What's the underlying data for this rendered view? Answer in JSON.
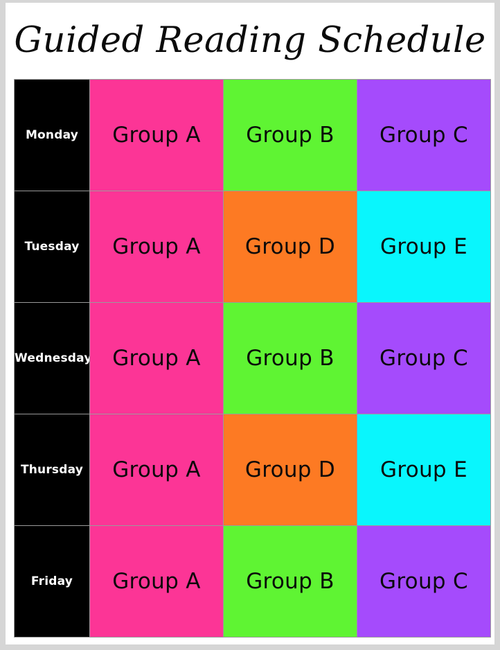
{
  "document": {
    "title": "Guided Reading Schedule",
    "page_background": "#ffffff",
    "canvas_background": "#d6d6d6"
  },
  "palette": {
    "day_column": "#000000",
    "day_text": "#ffffff",
    "group_text": "#0a0a0a",
    "grid_line": "#9a9a9a",
    "pink": "#fc3596",
    "green": "#5ff433",
    "purple": "#a54bfc",
    "orange": "#fd7a23",
    "cyan": "#09f6fd"
  },
  "schedule": {
    "rows": [
      {
        "day": "Monday",
        "slots": [
          {
            "label": "Group A",
            "color_key": "pink",
            "color": "#fc3596"
          },
          {
            "label": "Group B",
            "color_key": "green",
            "color": "#5ff433"
          },
          {
            "label": "Group C",
            "color_key": "purple",
            "color": "#a54bfc"
          }
        ]
      },
      {
        "day": "Tuesday",
        "slots": [
          {
            "label": "Group A",
            "color_key": "pink",
            "color": "#fc3596"
          },
          {
            "label": "Group D",
            "color_key": "orange",
            "color": "#fd7a23"
          },
          {
            "label": "Group E",
            "color_key": "cyan",
            "color": "#09f6fd"
          }
        ]
      },
      {
        "day": "Wednesday",
        "slots": [
          {
            "label": "Group A",
            "color_key": "pink",
            "color": "#fc3596"
          },
          {
            "label": "Group B",
            "color_key": "green",
            "color": "#5ff433"
          },
          {
            "label": "Group C",
            "color_key": "purple",
            "color": "#a54bfc"
          }
        ]
      },
      {
        "day": "Thursday",
        "slots": [
          {
            "label": "Group A",
            "color_key": "pink",
            "color": "#fc3596"
          },
          {
            "label": "Group D",
            "color_key": "orange",
            "color": "#fd7a23"
          },
          {
            "label": "Group E",
            "color_key": "cyan",
            "color": "#09f6fd"
          }
        ]
      },
      {
        "day": "Friday",
        "slots": [
          {
            "label": "Group A",
            "color_key": "pink",
            "color": "#fc3596"
          },
          {
            "label": "Group B",
            "color_key": "green",
            "color": "#5ff433"
          },
          {
            "label": "Group C",
            "color_key": "purple",
            "color": "#a54bfc"
          }
        ]
      }
    ]
  }
}
